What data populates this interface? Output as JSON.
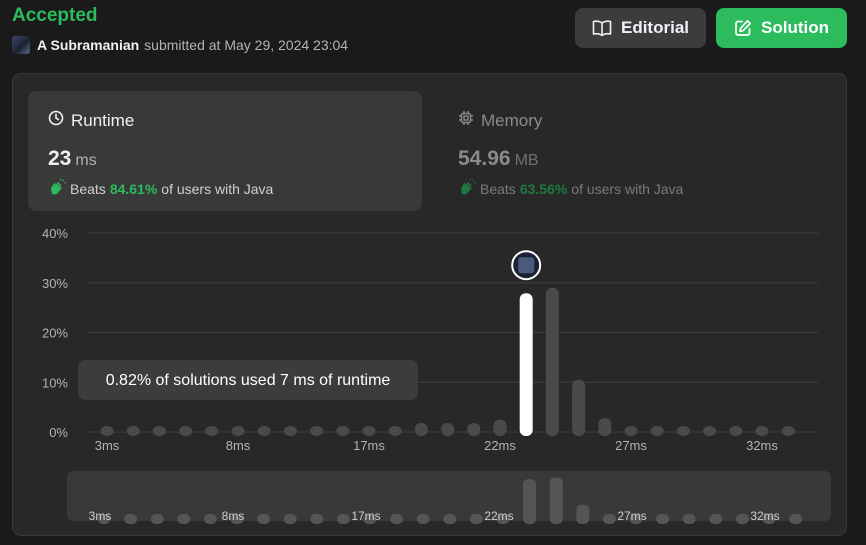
{
  "header": {
    "status": "Accepted",
    "submitter": "A Subramanian",
    "submitted_text": "submitted at May 29, 2024 23:04",
    "editorial_label": "Editorial",
    "solution_label": "Solution"
  },
  "runtime": {
    "title": "Runtime",
    "value": "23",
    "unit": "ms",
    "beats_label": "Beats",
    "beats_pct": "84.61%",
    "beats_suffix": "of users with Java"
  },
  "memory": {
    "title": "Memory",
    "value": "54.96",
    "unit": "MB",
    "beats_label": "Beats",
    "beats_pct": "63.56%",
    "beats_suffix": "of users with Java"
  },
  "tooltip": "0.82% of solutions used 7 ms of runtime",
  "colors": {
    "accent": "#2cbb5d",
    "bar": "#4a4a4a",
    "selected_bar": "#ffffff"
  },
  "chart_data": {
    "type": "bar",
    "ylim": [
      0,
      40
    ],
    "yticks": [
      "0%",
      "10%",
      "20%",
      "30%",
      "40%"
    ],
    "xticks": [
      "3ms",
      "8ms",
      "17ms",
      "22ms",
      "27ms",
      "32ms"
    ],
    "xtick_bins": [
      0,
      5,
      10,
      15,
      20,
      25
    ],
    "values": [
      0.9,
      0.9,
      0.9,
      0.9,
      0.9,
      0.9,
      0.9,
      0.9,
      0.9,
      0.9,
      0.9,
      0.9,
      1.8,
      1.8,
      1.8,
      2.5,
      27.9,
      29.0,
      10.5,
      2.8,
      0.9,
      0.9,
      0.9,
      0.9,
      0.9,
      0.9,
      0.9
    ],
    "selected_index": 16,
    "mini_xticks": [
      "3ms",
      "8ms",
      "17ms",
      "22ms",
      "27ms",
      "32ms"
    ],
    "mini_xtick_bins": [
      0,
      5,
      10,
      15,
      20,
      25
    ]
  }
}
